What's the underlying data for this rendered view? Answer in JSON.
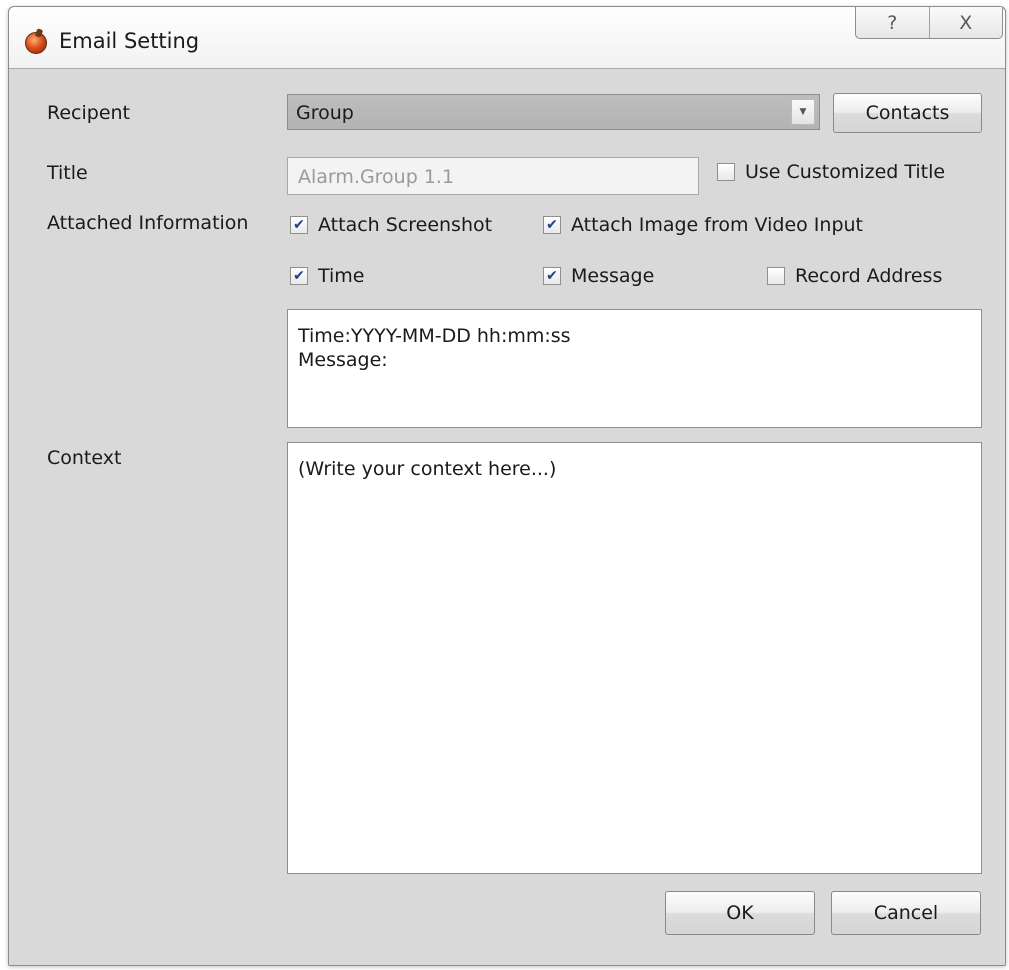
{
  "window": {
    "title": "Email Setting",
    "help_glyph": "?",
    "close_glyph": "X"
  },
  "form": {
    "recipient_label": "Recipent",
    "recipient_value": "Group",
    "contacts_button": "Contacts",
    "title_label": "Title",
    "title_value": "Alarm.Group 1.1",
    "use_customized_title": {
      "label": "Use Customized Title",
      "checked": false
    },
    "attached_label": "Attached Information",
    "attach_options": [
      {
        "label": "Attach Screenshot",
        "checked": true
      },
      {
        "label": "Attach Image from Video Input",
        "checked": true
      },
      {
        "label": "Time",
        "checked": true
      },
      {
        "label": "Message",
        "checked": true
      },
      {
        "label": "Record Address",
        "checked": false
      }
    ],
    "info_preview": "Time:YYYY-MM-DD hh:mm:ss\nMessage:",
    "context_label": "Context",
    "context_placeholder": "(Write your context here...)"
  },
  "buttons": {
    "ok": "OK",
    "cancel": "Cancel"
  },
  "icons": {
    "app": "bomb-icon",
    "help": "help-icon",
    "close": "close-icon",
    "dropdown": "chevron-down-icon",
    "check": "checkmark-icon"
  }
}
